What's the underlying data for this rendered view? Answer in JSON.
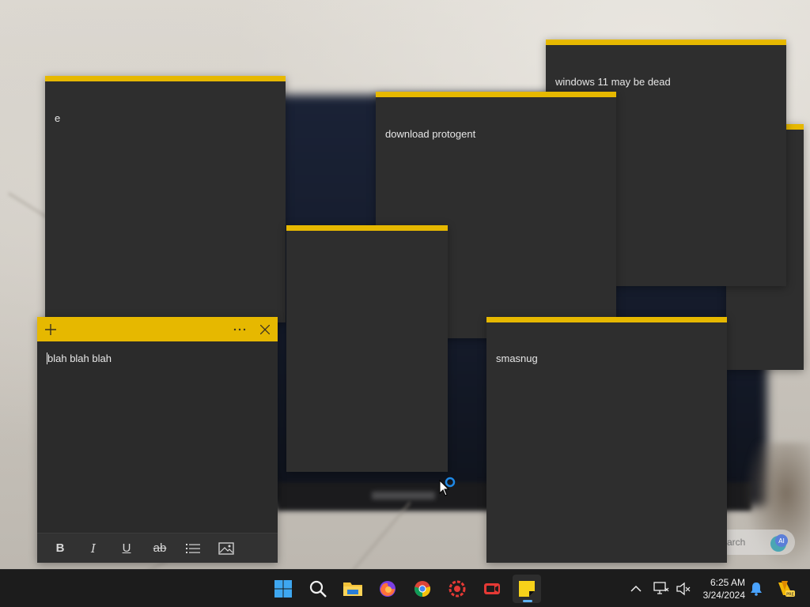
{
  "notes": {
    "note_e": {
      "text": "e"
    },
    "note_windows": {
      "text": "windows 11 may be dead"
    },
    "note_download": {
      "text": "download protogent"
    },
    "note_empty": {
      "text": ""
    },
    "note_smasnug": {
      "text": "smasnug"
    }
  },
  "active_note": {
    "text": "blah blah blah",
    "add_icon": "plus-icon",
    "menu_icon": "more-icon",
    "close_icon": "close-icon",
    "format": {
      "bold": "B",
      "italic": "I",
      "underline": "U",
      "strikethrough": "ab"
    }
  },
  "desktop": {
    "search_partial": "arch"
  },
  "taskbar": {
    "time": "6:25 AM",
    "date": "3/24/2024",
    "apps": [
      "start",
      "search",
      "file-explorer",
      "firefox",
      "chrome",
      "app-red",
      "screen-recorder",
      "sticky-notes"
    ]
  },
  "colors": {
    "note_accent": "#e6b800",
    "note_body": "#2e2e2e",
    "taskbar": "#1c1c1c",
    "active_indicator": "#5fb2f2"
  }
}
